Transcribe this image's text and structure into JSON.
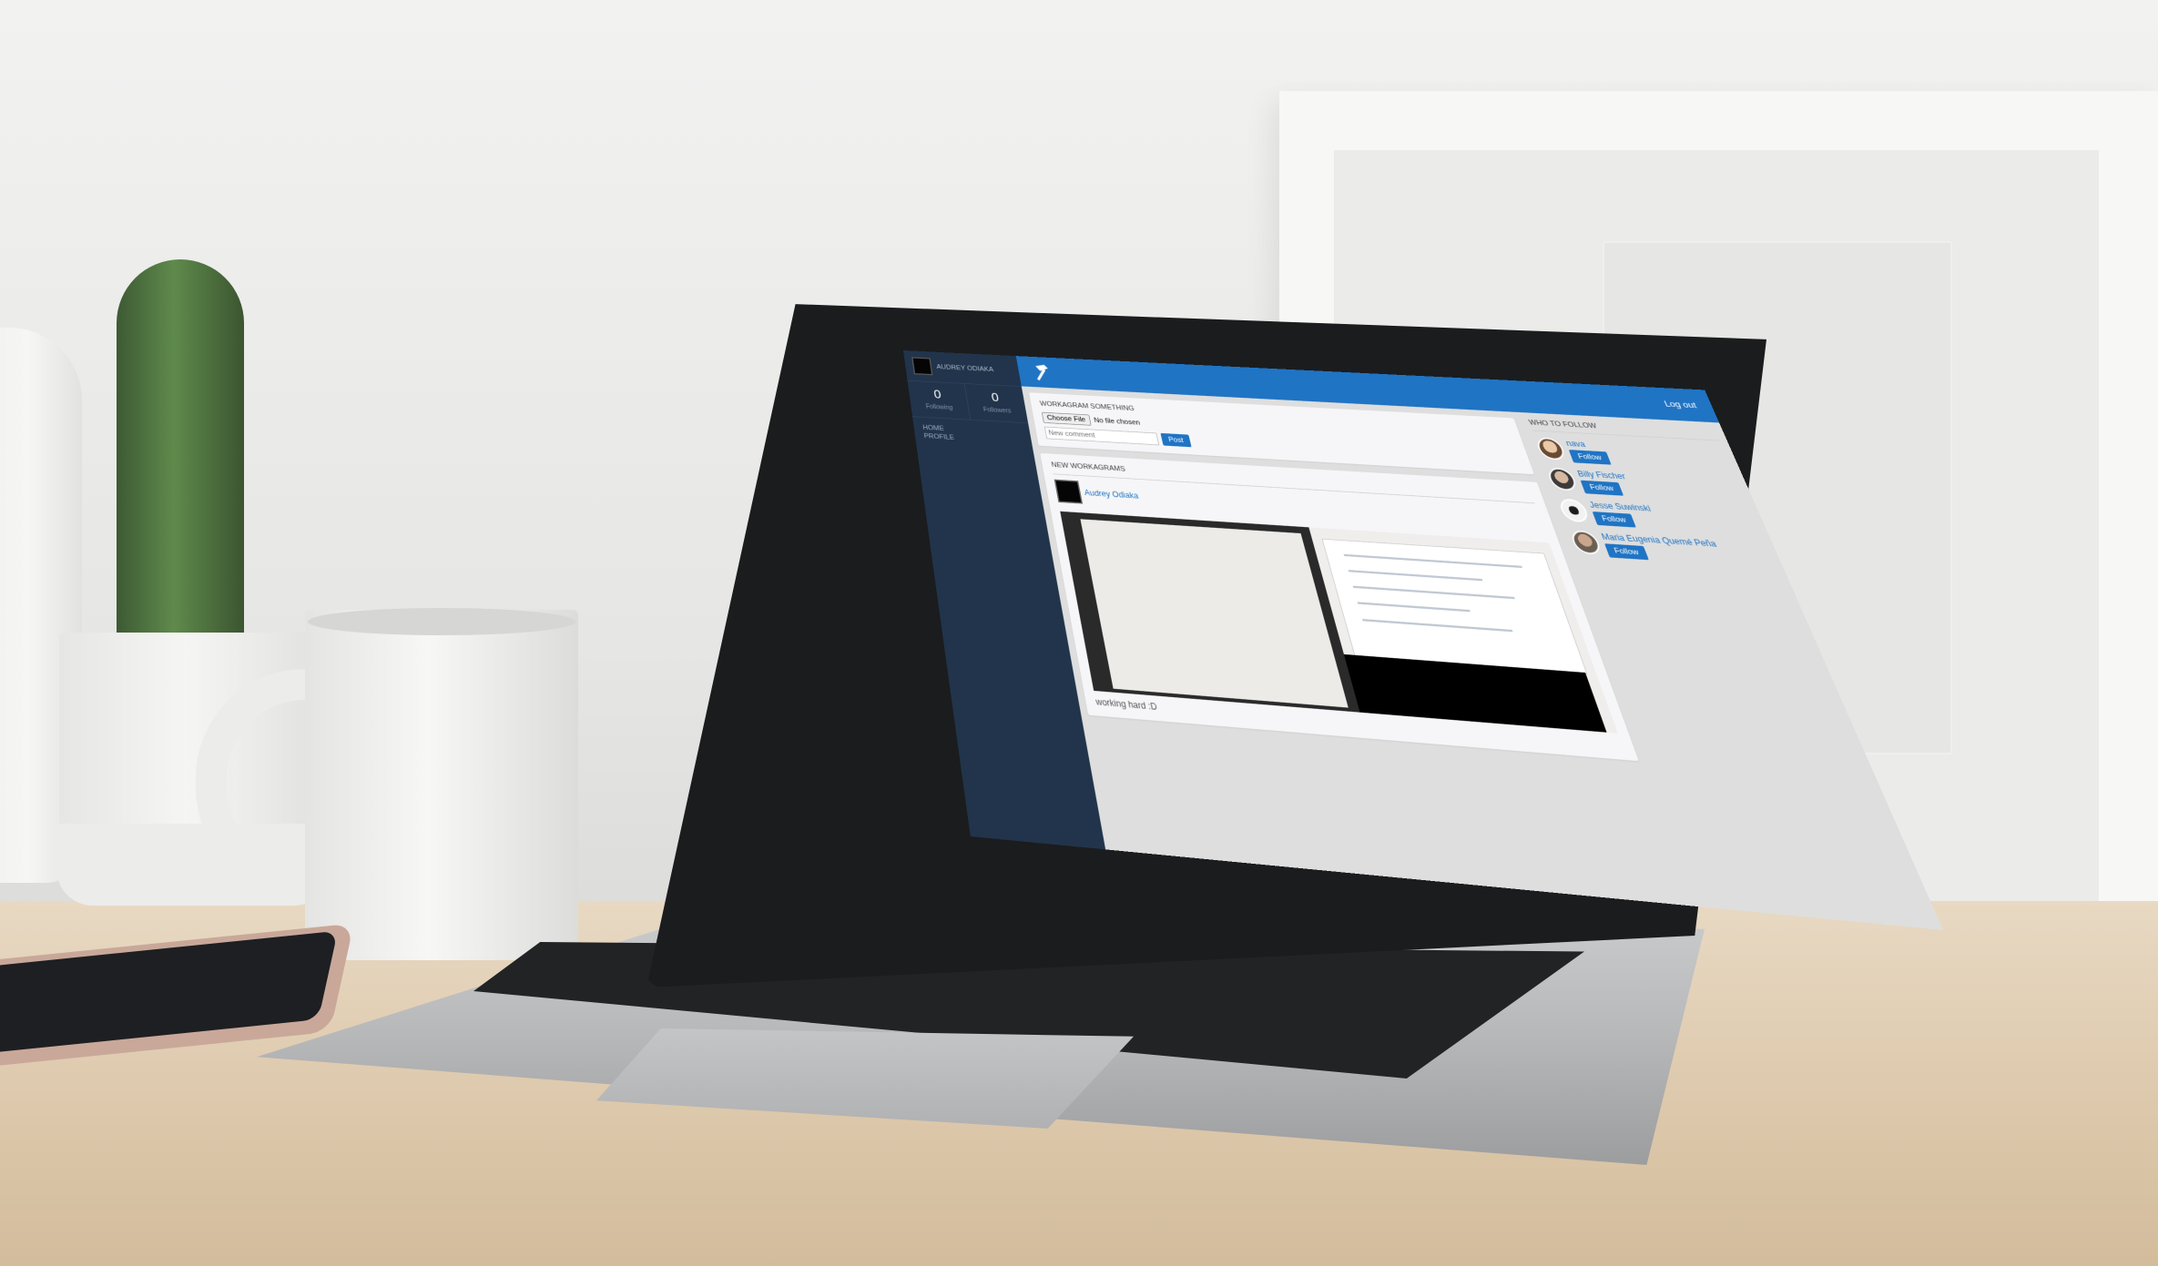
{
  "sidebar": {
    "user_name": "AUDREY ODIAKA",
    "following_count": "0",
    "following_label": "Following",
    "followers_count": "0",
    "followers_label": "Followers",
    "nav": [
      {
        "label": "HOME"
      },
      {
        "label": "PROFILE"
      }
    ]
  },
  "topbar": {
    "logo_icon": "hammer-icon",
    "logout_label": "Log out"
  },
  "compose": {
    "title": "WORKAGRAM SOMETHING",
    "choose_file_label": "Choose File",
    "file_status": "No file chosen",
    "comment_placeholder": "New comment",
    "post_label": "Post"
  },
  "feed": {
    "title": "NEW WORKAGRAMS",
    "post": {
      "author": "Audrey Odiaka",
      "caption": "working hard :D"
    }
  },
  "who_to_follow": {
    "title": "WHO TO FOLLOW",
    "button_label": "Follow",
    "users": [
      {
        "name": "nava"
      },
      {
        "name": "Billy Fischer"
      },
      {
        "name": "Jesse Suwinski"
      },
      {
        "name": "Maria Eugenia Quemé Peña"
      }
    ]
  },
  "colors": {
    "sidebar": "#21344b",
    "topbar": "#1f74c4",
    "accent": "#1f74c4"
  }
}
